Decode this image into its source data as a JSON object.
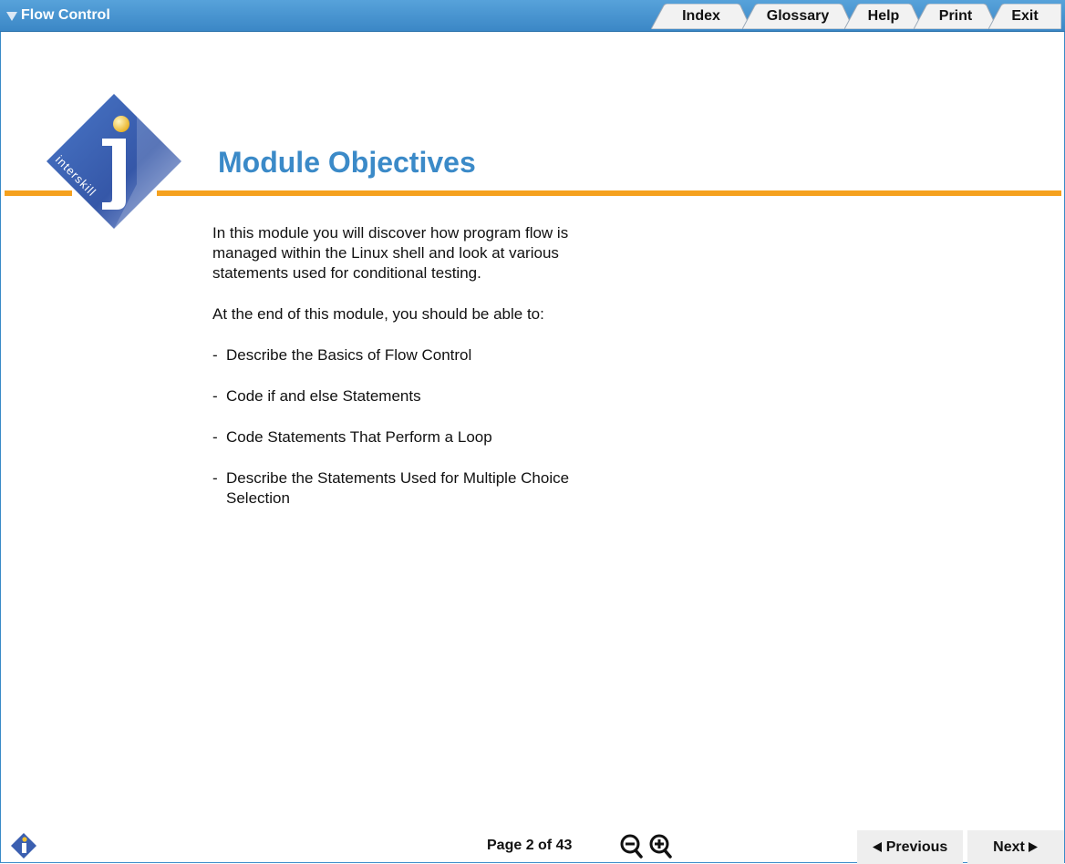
{
  "header": {
    "module_title": "Flow Control",
    "tabs": [
      "Index",
      "Glossary",
      "Help",
      "Print",
      "Exit"
    ]
  },
  "logo": {
    "text": "interskill"
  },
  "page": {
    "title": "Module Objectives",
    "intro": "In this module you will discover how program flow is managed within the Linux shell and look at various statements used for conditional testing.",
    "lead": "At the end of this module, you should be able to:",
    "objectives": [
      "Describe the Basics of Flow Control",
      "Code if and else Statements",
      "Code Statements That Perform a Loop",
      "Describe the Statements Used for Multiple Choice Selection"
    ]
  },
  "footer": {
    "page_indicator": "Page 2 of 43",
    "previous_label": "Previous",
    "next_label": "Next",
    "icons": [
      "info-icon",
      "zoom-out-icon",
      "zoom-in-icon",
      "triangle-left-icon",
      "triangle-right-icon"
    ]
  },
  "colors": {
    "header_blue": "#3b87c6",
    "title_blue": "#3b8ac8",
    "accent_orange": "#f5a11e",
    "logo_blue": "#3b5fb0"
  }
}
